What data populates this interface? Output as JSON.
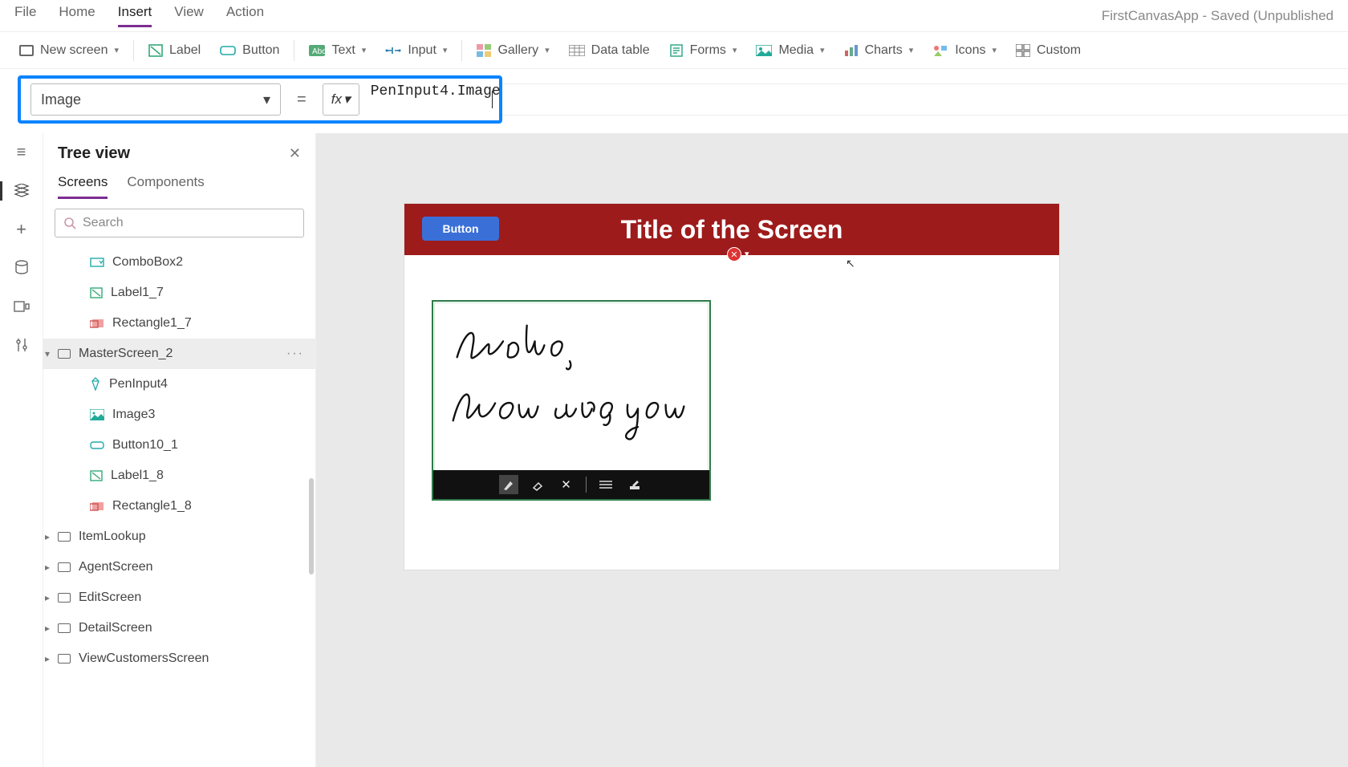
{
  "app_title": "FirstCanvasApp - Saved (Unpublished",
  "menu": {
    "file": "File",
    "home": "Home",
    "insert": "Insert",
    "view": "View",
    "action": "Action"
  },
  "ribbon": {
    "new_screen": "New screen",
    "label": "Label",
    "button": "Button",
    "text": "Text",
    "input": "Input",
    "gallery": "Gallery",
    "datatable": "Data table",
    "forms": "Forms",
    "media": "Media",
    "charts": "Charts",
    "icons": "Icons",
    "custom": "Custom"
  },
  "formula_bar": {
    "property": "Image",
    "fx": "fx",
    "formula": "PenInput4.Image"
  },
  "sidebar": {
    "title": "Tree view",
    "tabs": {
      "screens": "Screens",
      "components": "Components"
    },
    "search_placeholder": "Search",
    "items": {
      "combobox2": "ComboBox2",
      "label1_7": "Label1_7",
      "rectangle1_7": "Rectangle1_7",
      "masterscreen_2": "MasterScreen_2",
      "peninput4": "PenInput4",
      "image3": "Image3",
      "button10_1": "Button10_1",
      "label1_8": "Label1_8",
      "rectangle1_8": "Rectangle1_8",
      "itemlookup": "ItemLookup",
      "agentscreen": "AgentScreen",
      "editscreen": "EditScreen",
      "detailscreen": "DetailScreen",
      "viewcustomers": "ViewCustomersScreen"
    }
  },
  "canvas": {
    "button_text": "Button",
    "screen_title": "Title of the Screen",
    "ink_text1": "Hello,",
    "ink_text2": "How are you"
  }
}
